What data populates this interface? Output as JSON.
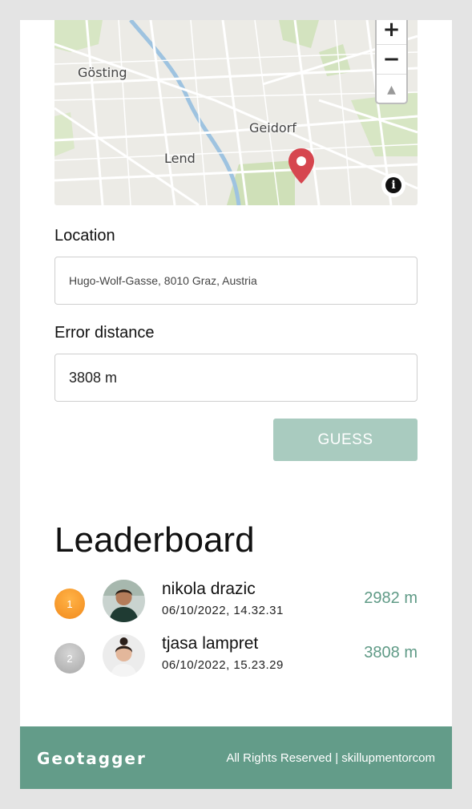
{
  "map": {
    "labels": {
      "gosting": "Gösting",
      "lend": "Lend",
      "geidorf": "Geidorf"
    },
    "zoom_in": "+",
    "zoom_out": "−",
    "compass": "▲",
    "info": "i"
  },
  "form": {
    "location_label": "Location",
    "location_value": "Hugo-Wolf-Gasse, 8010 Graz, Austria",
    "error_label": "Error distance",
    "error_value": "3808 m",
    "guess_button": "GUESS"
  },
  "leaderboard": {
    "title": "Leaderboard",
    "entries": [
      {
        "rank": "1",
        "name": "nikola drazic",
        "date": "06/10/2022, 14.32.31",
        "distance": "2982 m"
      },
      {
        "rank": "2",
        "name": "tjasa lampret",
        "date": "06/10/2022, 15.23.29",
        "distance": "3808 m"
      }
    ]
  },
  "footer": {
    "brand": "Geotagger",
    "rights": "All Rights Reserved | skillupmentorcom"
  },
  "colors": {
    "accent": "#639c89",
    "guess_button": "#a9cbbf",
    "distance_text": "#5f9a86",
    "gold": "#f6a12e",
    "silver": "#b8b8b8",
    "pin": "#d6464f"
  }
}
